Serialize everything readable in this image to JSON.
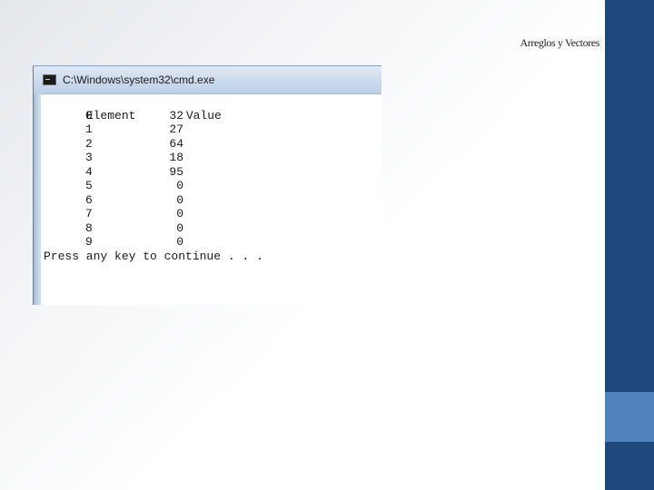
{
  "slide": {
    "title": "Arreglos y Vectores"
  },
  "cmd": {
    "title": "C:\\Windows\\system32\\cmd.exe",
    "headers": {
      "element": "Element",
      "value": "Value"
    },
    "rows": [
      {
        "element": "0",
        "value": "32"
      },
      {
        "element": "1",
        "value": "27"
      },
      {
        "element": "2",
        "value": "64"
      },
      {
        "element": "3",
        "value": "18"
      },
      {
        "element": "4",
        "value": "95"
      },
      {
        "element": "5",
        "value": "0"
      },
      {
        "element": "6",
        "value": "0"
      },
      {
        "element": "7",
        "value": "0"
      },
      {
        "element": "8",
        "value": "0"
      },
      {
        "element": "9",
        "value": "0"
      }
    ],
    "prompt": "Press any key to continue . . ."
  },
  "colors": {
    "sidebar": "#1f497d",
    "sidebar_accent": "#4f81bd"
  }
}
